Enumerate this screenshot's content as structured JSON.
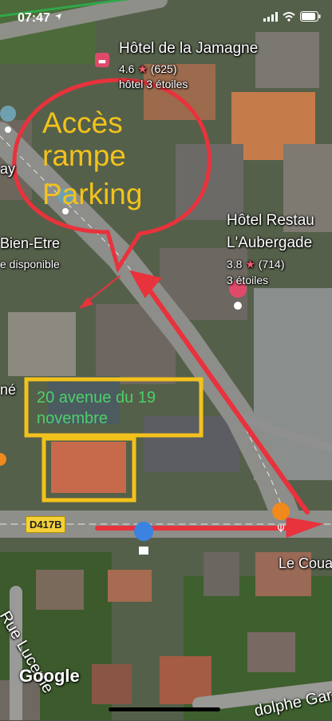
{
  "status_bar": {
    "time": "07:47"
  },
  "map": {
    "places": [
      {
        "name": "Hôtel de la Jamagne",
        "rating": "4.6",
        "reviews": "(625)",
        "category": "hôtel 3 étoiles"
      },
      {
        "name": "Hôtel Restau",
        "name_line2": "L'Aubergade",
        "rating": "3.8",
        "reviews": "(714)",
        "category": "3 étoiles"
      }
    ],
    "poi_partial": {
      "left_top": "ay",
      "name": "Bien-Etre",
      "sub": "e disponible",
      "left_mid": "né"
    },
    "restaurant": "Le Coua",
    "road_badge": "D417B",
    "streets": {
      "rue": "Rue Lucerne",
      "avenue": "dolphe Gar"
    },
    "attribution": "Google"
  },
  "annotations": {
    "bubble_text": [
      "Accès",
      "rampe",
      "Parking"
    ],
    "address_text": [
      "20 avenue du 19",
      "novembre"
    ],
    "colors": {
      "arrow": "#e8323c",
      "bubble_text": "#f2c21c",
      "box": "#f2c21c",
      "address": "#4bd06a"
    }
  }
}
